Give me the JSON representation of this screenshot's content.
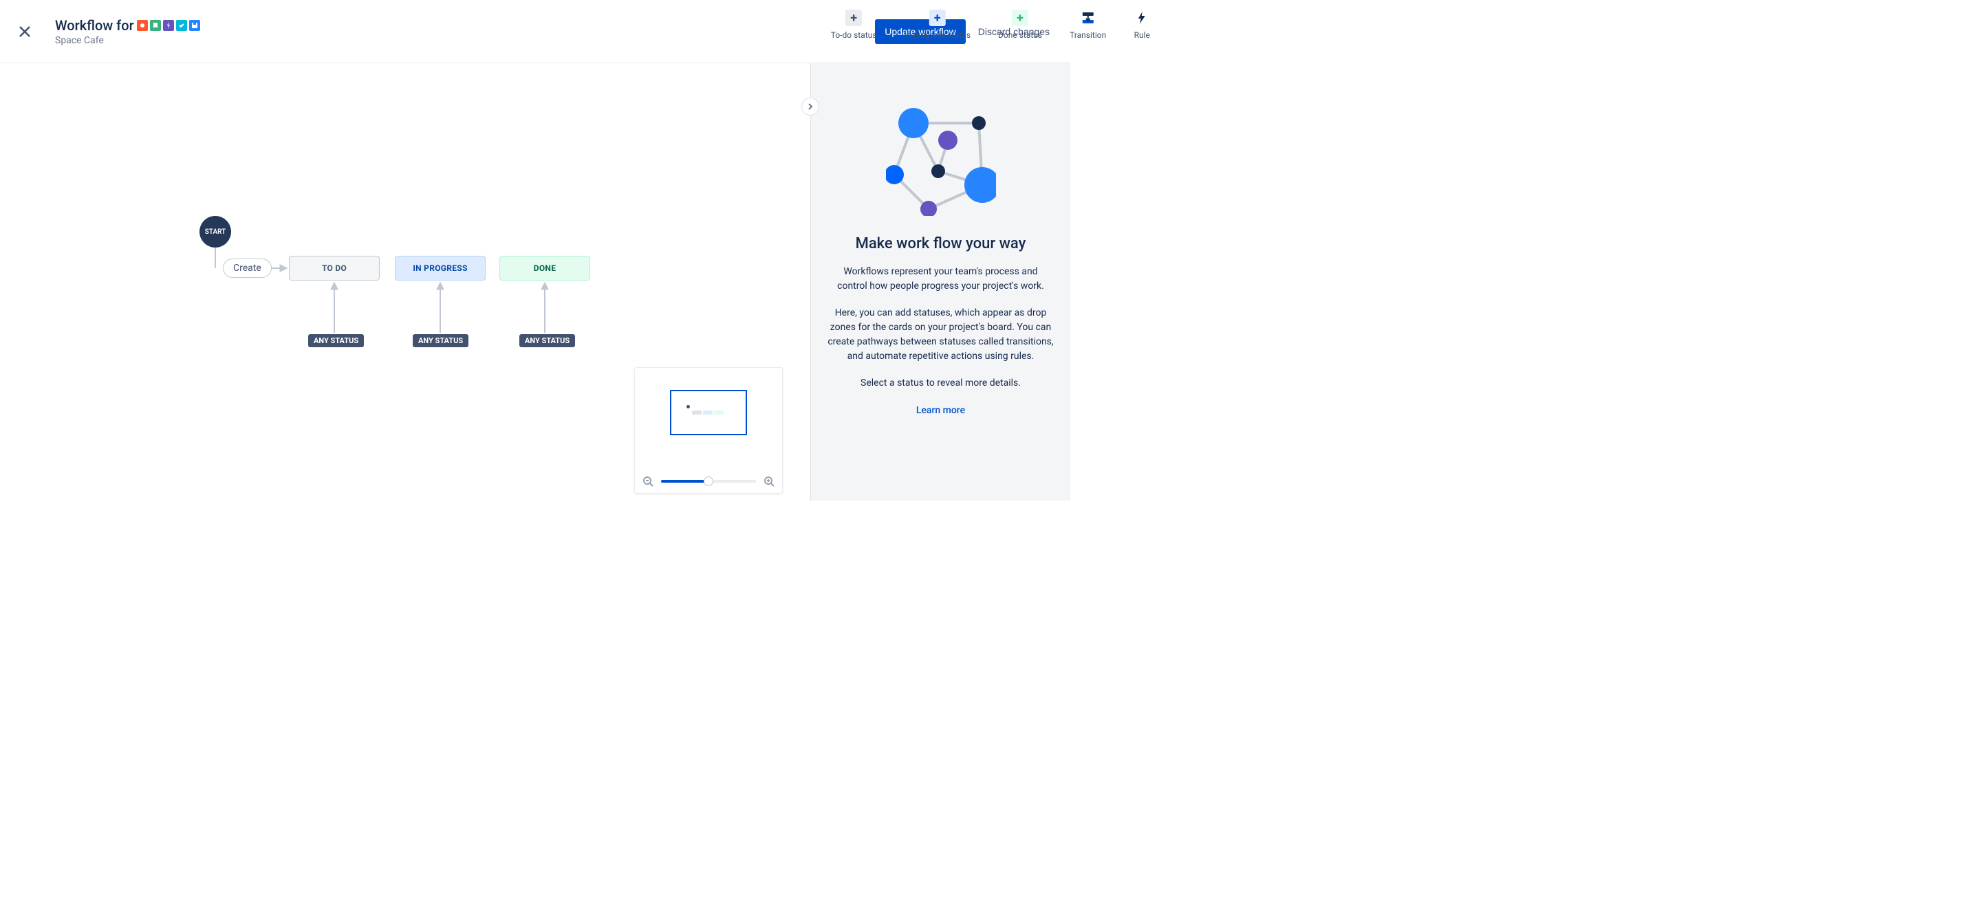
{
  "header": {
    "title_prefix": "Workflow for",
    "subtitle": "Space Cafe",
    "icons": [
      {
        "bg": "#FF5630",
        "glyph": "dot"
      },
      {
        "bg": "#36B37E",
        "glyph": "bookmark"
      },
      {
        "bg": "#6554C0",
        "glyph": "bolt"
      },
      {
        "bg": "#00B8D9",
        "glyph": "check"
      },
      {
        "bg": "#2684FF",
        "glyph": "save"
      }
    ]
  },
  "toolbar": [
    {
      "label": "To-do status",
      "icon_bg": "#EBECF0",
      "icon_color": "#42526E",
      "glyph": "plus"
    },
    {
      "label": "In-progress status",
      "icon_bg": "#DEEBFF",
      "icon_color": "#0052CC",
      "glyph": "plus"
    },
    {
      "label": "Done status",
      "icon_bg": "#E3FCEF",
      "icon_color": "#36B37E",
      "glyph": "plus"
    },
    {
      "label": "Transition",
      "icon_bg": "transparent",
      "icon_color": "#172B4D",
      "glyph": "transition"
    },
    {
      "label": "Rule",
      "icon_bg": "transparent",
      "icon_color": "#172B4D",
      "glyph": "bolt"
    }
  ],
  "actions": {
    "primary": "Update workflow",
    "discard": "Discard changes"
  },
  "canvas": {
    "start": "START",
    "create": "Create",
    "statuses": [
      {
        "label": "TO DO",
        "kind": "todo"
      },
      {
        "label": "IN PROGRESS",
        "kind": "in-progress"
      },
      {
        "label": "DONE",
        "kind": "done"
      }
    ],
    "any_status_label": "ANY STATUS"
  },
  "sidepanel": {
    "heading": "Make work flow your way",
    "p1": "Workflows represent your team's process and control how people progress your project's work.",
    "p2": "Here, you can add statuses, which appear as drop zones for the cards on your project's board. You can create pathways between statuses called transitions, and automate repetitive actions using rules.",
    "p3": "Select a status to reveal more details.",
    "learn_more": "Learn more"
  }
}
